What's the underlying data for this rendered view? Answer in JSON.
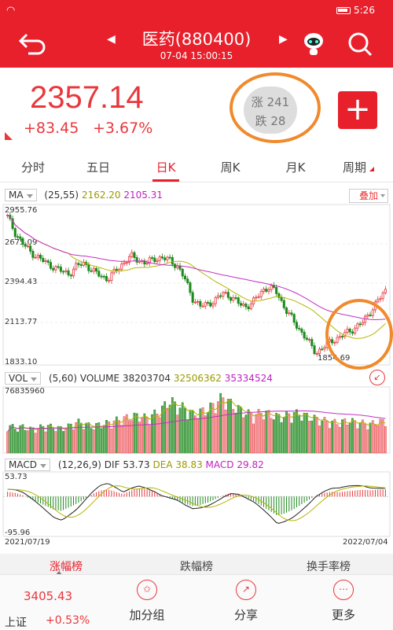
{
  "status_bar": {
    "time": "5:26",
    "wifi_icon": "wifi-icon",
    "battery_icon": "battery-icon"
  },
  "header": {
    "title": "医药(880400)",
    "datetime": "07-04 15:00:15",
    "prev_arrow": "◀",
    "next_arrow": "▶"
  },
  "quote": {
    "price": "2357.14",
    "change": "+83.45",
    "change_pct": "+3.67%"
  },
  "breadth": {
    "up_label": "涨 241",
    "down_label": "跌 28"
  },
  "add_button": {
    "label": "+"
  },
  "tabs": [
    "分时",
    "五日",
    "日K",
    "周K",
    "月K",
    "周期"
  ],
  "active_tab": "日K",
  "ma_legend": {
    "selector": "MA",
    "params": "(25,55)",
    "ma1": "2162.20",
    "ma2": "2105.31",
    "overlay_button": "叠加"
  },
  "vol_legend": {
    "selector": "VOL",
    "params": "(5,60) VOLUME",
    "volume": "38203704",
    "ma1": "32506362",
    "ma2": "35334524"
  },
  "macd_legend": {
    "selector": "MACD",
    "params": "(12,26,9) DIF",
    "dif": "53.73",
    "dea_label": "DEA",
    "dea": "38.83",
    "macd_label": "MACD",
    "macd": "29.82"
  },
  "price_axis": [
    "2955.76",
    "2675.09",
    "2394.43",
    "2113.77",
    "1833.10"
  ],
  "low_marker": "1854.69",
  "vol_axis_top": "76835960",
  "macd_axis": [
    "53.73",
    "-95.96"
  ],
  "date_range": {
    "start": "2021/07/19",
    "end": "2022/07/04"
  },
  "rank_tabs": [
    "涨幅榜",
    "跌幅榜",
    "换手率榜"
  ],
  "bottom": {
    "index_value": "3405.43",
    "index_name": "上证",
    "index_pct": "+0.53%",
    "actions": [
      {
        "label": "加分组",
        "icon": "star-icon",
        "glyph": "✩"
      },
      {
        "label": "分享",
        "icon": "share-icon",
        "glyph": "↗"
      },
      {
        "label": "更多",
        "icon": "more-icon",
        "glyph": "⋯"
      }
    ]
  },
  "colors": {
    "brand_red": "#e8202c",
    "up": "#e8383d",
    "down": "#1e8a1e",
    "ma1": "#b5b500",
    "ma2": "#c030c0",
    "highlight": "#f08a2c"
  },
  "chart_data": [
    {
      "type": "candlestick",
      "title": "日K",
      "x_range": [
        "2021/07/19",
        "2022/07/04"
      ],
      "ylim": [
        1833.1,
        2955.76
      ],
      "close_series_approx": [
        2900,
        2780,
        2700,
        2640,
        2600,
        2560,
        2530,
        2500,
        2480,
        2540,
        2560,
        2500,
        2470,
        2440,
        2500,
        2560,
        2610,
        2580,
        2560,
        2590,
        2600,
        2580,
        2540,
        2440,
        2300,
        2240,
        2260,
        2290,
        2340,
        2310,
        2260,
        2240,
        2280,
        2360,
        2380,
        2340,
        2220,
        2140,
        2060,
        1980,
        1900,
        1940,
        1990,
        2010,
        2050,
        2080,
        2120,
        2200,
        2280,
        2357.14
      ],
      "series": [
        {
          "name": "MA25",
          "last": 2162.2
        },
        {
          "name": "MA55",
          "last": 2105.31
        }
      ],
      "annotations": [
        "1854.69"
      ]
    },
    {
      "type": "bar",
      "title": "VOL",
      "ylim": [
        0,
        76835960
      ],
      "values_approx": [
        0.45,
        0.4,
        0.42,
        0.38,
        0.4,
        0.44,
        0.41,
        0.39,
        0.43,
        0.5,
        0.47,
        0.42,
        0.46,
        0.48,
        0.52,
        0.55,
        0.58,
        0.6,
        0.56,
        0.62,
        0.7,
        0.85,
        0.75,
        0.72,
        0.62,
        0.66,
        0.7,
        0.8,
        0.9,
        0.78,
        0.7,
        0.64,
        0.6,
        0.66,
        0.62,
        0.58,
        0.6,
        0.64,
        0.62,
        0.58,
        0.55,
        0.52,
        0.5,
        0.48,
        0.52,
        0.5,
        0.48,
        0.46,
        0.5,
        0.5
      ],
      "series": [
        {
          "name": "VOLUME",
          "last": 38203704
        },
        {
          "name": "MA5",
          "last": 32506362
        },
        {
          "name": "MA60",
          "last": 35334524
        }
      ]
    },
    {
      "type": "bar",
      "title": "MACD",
      "ylim": [
        -95.96,
        53.73
      ],
      "hist_approx": [
        20,
        15,
        5,
        -10,
        -25,
        -40,
        -55,
        -60,
        -45,
        -30,
        -10,
        10,
        25,
        30,
        20,
        10,
        25,
        35,
        30,
        20,
        5,
        -5,
        -15,
        -30,
        -40,
        -35,
        -25,
        -10,
        5,
        15,
        10,
        -5,
        -20,
        -40,
        -60,
        -80,
        -70,
        -55,
        -35,
        -15,
        5,
        15,
        20,
        18,
        22,
        25,
        28,
        26,
        28,
        29.82
      ],
      "series": [
        {
          "name": "DIF",
          "last": 53.73
        },
        {
          "name": "DEA",
          "last": 38.83
        },
        {
          "name": "MACD",
          "last": 29.82
        }
      ]
    }
  ]
}
